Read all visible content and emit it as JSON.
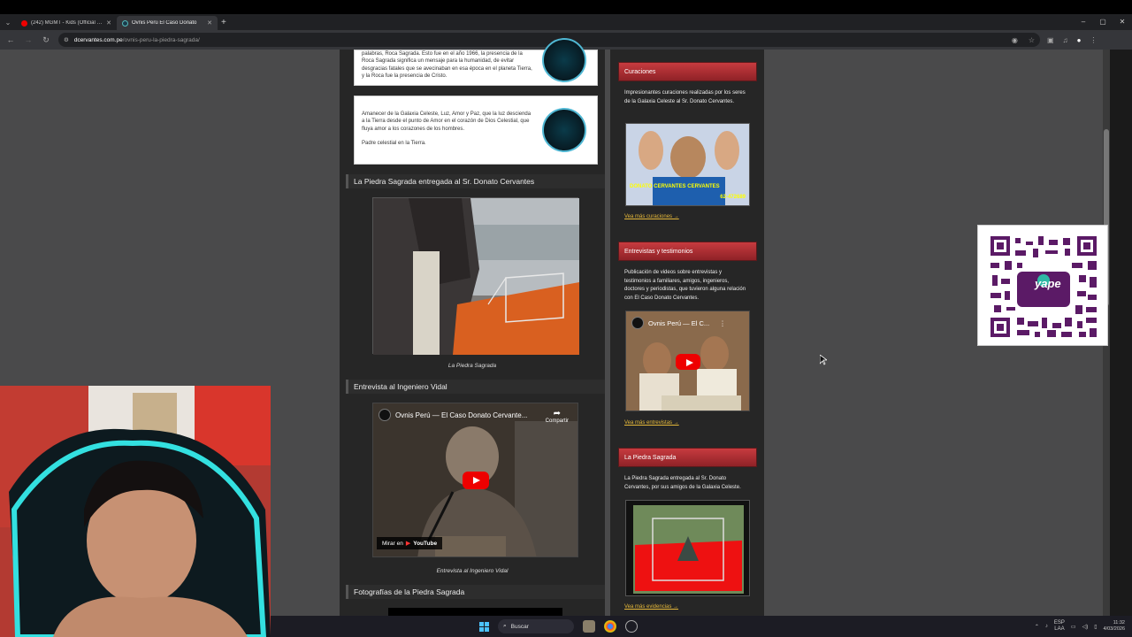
{
  "browser": {
    "tabs": [
      {
        "title": "(242) MGMT - Kids (Official HD",
        "active": false
      },
      {
        "title": "Ovnis Perú El Caso Donato",
        "active": true
      }
    ],
    "new_tab": "+",
    "window_controls": [
      "–",
      "▢",
      "✕"
    ],
    "url_domain": "dcervantes.com.pe",
    "url_path": "/ovnis-peru-la-piedra-sagrada/"
  },
  "main": {
    "card1_text": "palabras, Roca Sagrada. Esto fue en el año 1966, la presencia de la Roca Sagrada significa un mensaje para la humanidad, de evitar desgracias fatales que se avecinaban en esa época en el planeta Tierra, y la Roca fue la presencia de Cristo.",
    "card2_text": "Amanecer de la Galaxia Celeste, Luz, Amor y Paz, que la luz descienda a la Tierra desde el punto de Amor en el corazón de Dios Celestial, que fluya amor a los corazones de los hombres.",
    "card2_sign": "Padre celestial en la Tierra.",
    "section1_title": "La Piedra Sagrada entregada al Sr. Donato Cervantes",
    "photo1_caption": "La Piedra Sagrada",
    "section2_title": "Entrevista al Ingeniero Vidal",
    "video1_title": "Ovnis Perú — El Caso Donato Cervante...",
    "video1_share": "Compartir",
    "video1_watch": "Mirar en",
    "video1_yt": "YouTube",
    "video1_caption": "Entrevista al Ingeniero Vidal",
    "section3_title": "Fotografías de la Piedra Sagrada"
  },
  "sidebar": {
    "w1_title": "Curaciones",
    "w1_text": "Impresionantes curaciones realizadas por los seres de la Galaxia Celeste al Sr. Donato Cervantes.",
    "w1_img_text": "DONATO CERVANTES CERVANTES",
    "w1_img_phone": "62-472689",
    "w1_more": "Vea más curaciones →",
    "w2_title": "Entrevistas y testimonios",
    "w2_text": "Publicación de videos sobre entrevistas y testimonios a familiares, amigos, ingenieros, doctores y periodistas, que tuvieron alguna relación con El Caso Donato Cervantes.",
    "w2_video_title": "Ovnis Perú — El C...",
    "w2_more": "Vea más entrevistas →",
    "w3_title": "La Piedra Sagrada",
    "w3_text": "La Piedra Sagrada entregada al Sr. Donato Cervantes, por sus amigos de la Galaxia Celeste.",
    "w3_more": "Vea más evidencias →"
  },
  "qr": {
    "label": "yape"
  },
  "taskbar": {
    "search_label": "Buscar",
    "lang_top": "ESP",
    "lang_bottom": "LAA",
    "time": "11:32",
    "date": "4/03/2026"
  },
  "colors": {
    "accent_red": "#b62f34",
    "link_yellow": "#e6b93a",
    "page_bg": "#4a4a4b",
    "panel_bg": "#262626",
    "qr_purple": "#6a1b73"
  }
}
